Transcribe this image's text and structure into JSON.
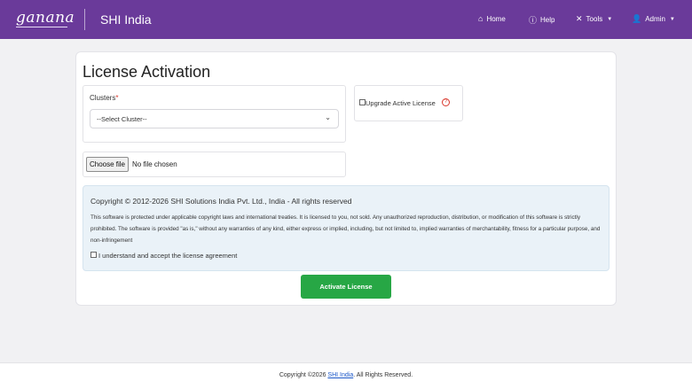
{
  "header": {
    "brand": "ganana",
    "org_name": "SHI India",
    "nav": {
      "home": "Home",
      "help": "Help",
      "tools": "Tools",
      "admin": "Admin"
    }
  },
  "main": {
    "title": "License Activation",
    "clusters": {
      "label": "Clusters",
      "required_marker": "*",
      "selected": "--Select Cluster--"
    },
    "upgrade": {
      "label": "Upgrade Active License",
      "checked": false
    },
    "file": {
      "button": "Choose file",
      "status": "No file chosen"
    },
    "license": {
      "title": "Copyright © 2012-2026 SHI Solutions India Pvt. Ltd., India - All rights reserved",
      "text": "This software is protected under applicable copyright laws and international treaties. It is licensed to you, not sold. Any unauthorized reproduction, distribution, or modification of this software is strictly prohibited. The software is provided \"as is,\" without any warranties of any kind, either express or implied, including, but not limited to, implied warranties of merchantability, fitness for a particular purpose, and non-infringement",
      "accept_label": "I understand and accept the license agreement",
      "accepted": false
    },
    "activate_button": "Activate License"
  },
  "footer": {
    "prefix": "Copyright ©2026 ",
    "link": "SHI India",
    "suffix": ". All Rights Reserved."
  },
  "colors": {
    "header": "#6a3a9a",
    "primary_button": "#27a745",
    "license_panel": "#eaf2f8",
    "required": "#d9362b",
    "link": "#1a56c8"
  },
  "icons": [
    "home-icon",
    "help-icon",
    "tools-icon",
    "user-icon",
    "chevron-down-icon",
    "info-icon"
  ]
}
